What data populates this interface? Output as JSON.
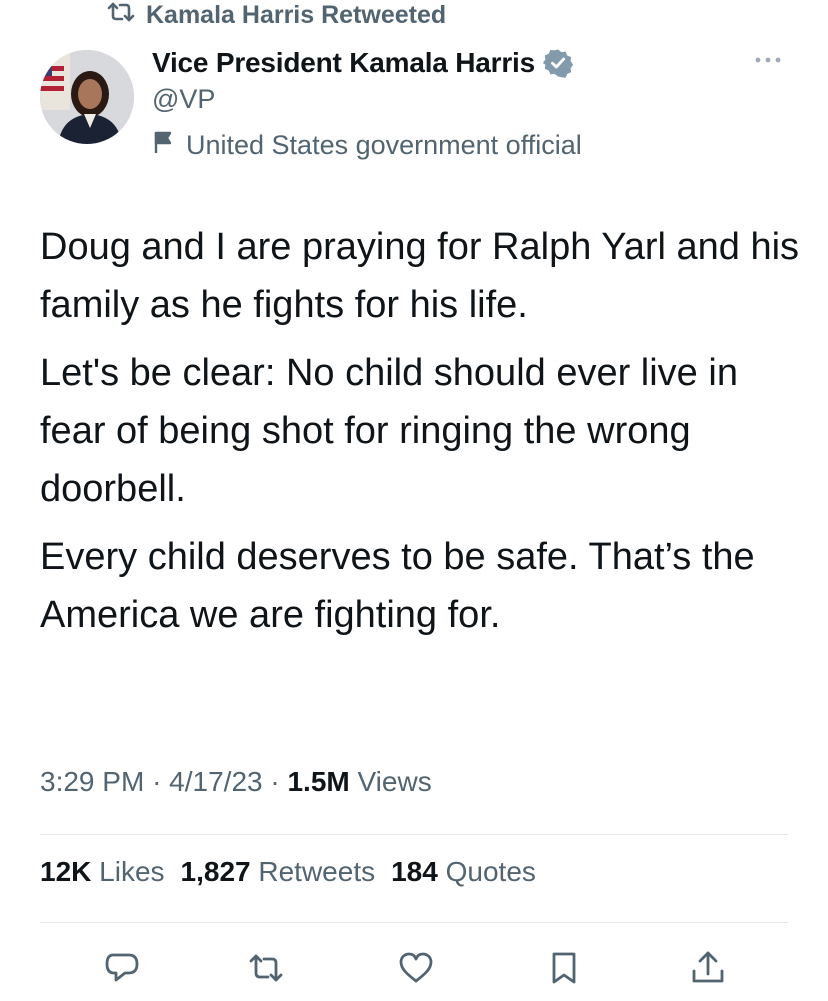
{
  "retweet_banner": {
    "icon": "retweet-icon",
    "text": "Kamala Harris Retweeted"
  },
  "author": {
    "name": "Vice President Kamala Harris",
    "handle": "@VP",
    "verified_icon": "verified-badge-icon",
    "label_icon": "flag-icon",
    "label": "United States government official"
  },
  "tweet": {
    "paragraphs": [
      "Doug and I are praying for Ralph Yarl and his family as he fights for his life.",
      "Let's be clear: No child should ever live in fear of being shot for ringing the wrong doorbell.",
      "Every child deserves to be safe. That’s the America we are fighting for."
    ]
  },
  "meta": {
    "time": "3:29 PM",
    "sep1": "·",
    "date": "4/17/23",
    "sep2": "·",
    "views_count": "1.5M",
    "views_label": "Views"
  },
  "stats": {
    "likes_count": "12K",
    "likes_label": "Likes",
    "retweets_count": "1,827",
    "retweets_label": "Retweets",
    "quotes_count": "184",
    "quotes_label": "Quotes"
  },
  "actions": {
    "reply_icon": "reply-icon",
    "retweet_icon": "retweet-icon",
    "like_icon": "heart-icon",
    "bookmark_icon": "bookmark-icon",
    "share_icon": "share-icon"
  },
  "colors": {
    "text": "#0f1419",
    "secondary": "#536471",
    "verified": "#829aab",
    "divider": "#e3e7ea"
  }
}
